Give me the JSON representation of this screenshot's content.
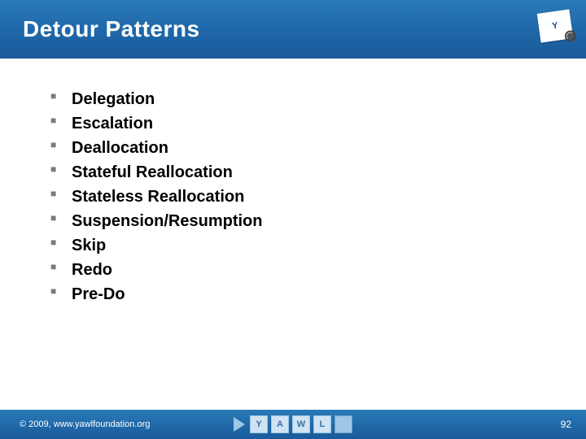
{
  "header": {
    "title": "Detour Patterns",
    "logo_text": "Y"
  },
  "bullets": [
    "Delegation",
    "Escalation",
    "Deallocation",
    "Stateful Reallocation",
    "Stateless Reallocation",
    "Suspension/Resumption",
    "Skip",
    "Redo",
    "Pre-Do"
  ],
  "footer": {
    "copyright": "© 2009, www.yawlfoundation.org",
    "page_number": "92",
    "logo_letters": [
      "Y",
      "A",
      "W",
      "L"
    ]
  }
}
